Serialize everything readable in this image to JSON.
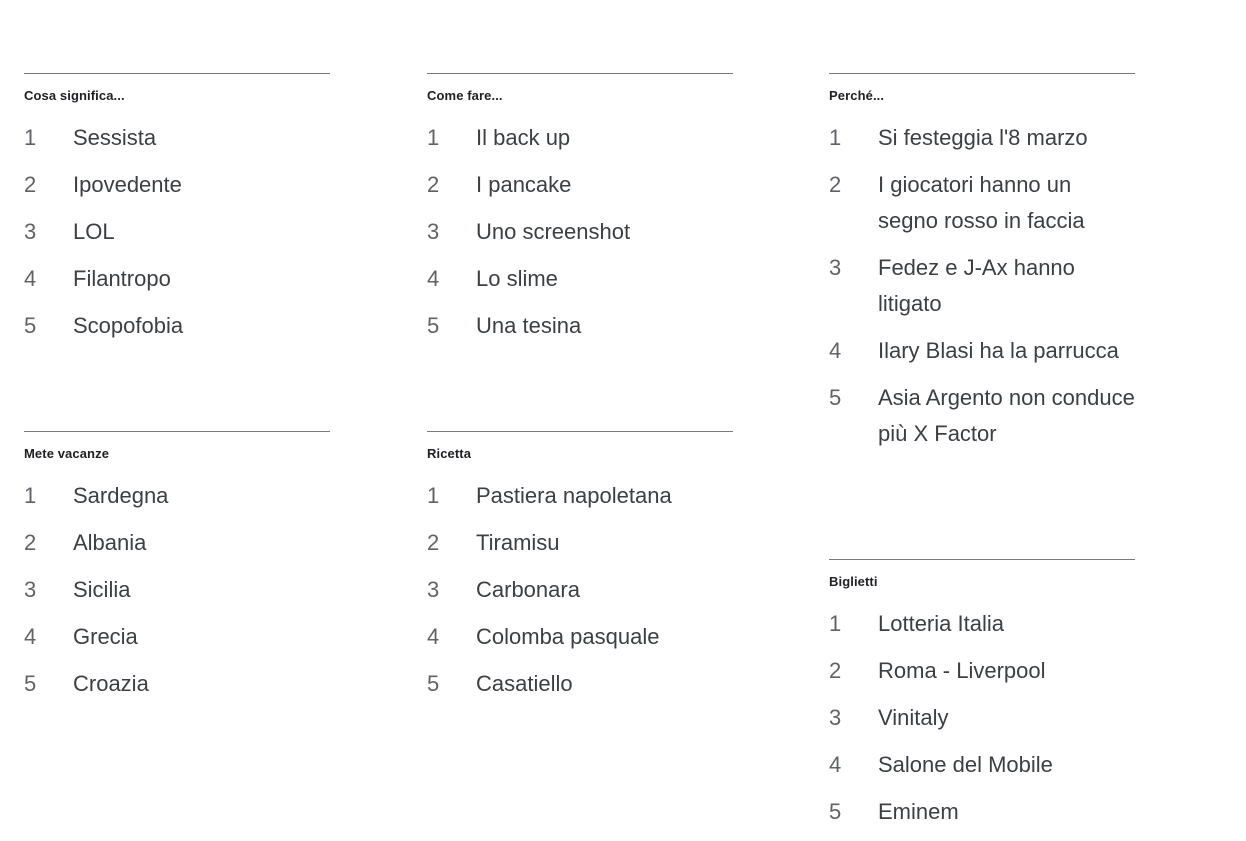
{
  "page": {
    "background_color": "#ffffff",
    "rule_color": "#5f6368",
    "title_color": "#202124",
    "rank_color": "#5f6368",
    "item_color": "#3c4043"
  },
  "columns": [
    {
      "name": "column-left",
      "cards": [
        {
          "title": "Cosa significa...",
          "items": [
            {
              "rank": "1",
              "label": "Sessista"
            },
            {
              "rank": "2",
              "label": "Ipovedente"
            },
            {
              "rank": "3",
              "label": "LOL"
            },
            {
              "rank": "4",
              "label": "Filantropo"
            },
            {
              "rank": "5",
              "label": "Scopofobia"
            }
          ]
        },
        {
          "title": "Mete vacanze",
          "items": [
            {
              "rank": "1",
              "label": "Sardegna"
            },
            {
              "rank": "2",
              "label": "Albania"
            },
            {
              "rank": "3",
              "label": "Sicilia"
            },
            {
              "rank": "4",
              "label": "Grecia"
            },
            {
              "rank": "5",
              "label": "Croazia"
            }
          ]
        }
      ]
    },
    {
      "name": "column-middle",
      "cards": [
        {
          "title": "Come fare...",
          "items": [
            {
              "rank": "1",
              "label": "Il back up"
            },
            {
              "rank": "2",
              "label": "I pancake"
            },
            {
              "rank": "3",
              "label": "Uno screenshot"
            },
            {
              "rank": "4",
              "label": "Lo slime"
            },
            {
              "rank": "5",
              "label": "Una tesina"
            }
          ]
        },
        {
          "title": "Ricetta",
          "items": [
            {
              "rank": "1",
              "label": "Pastiera napoletana"
            },
            {
              "rank": "2",
              "label": "Tiramisu"
            },
            {
              "rank": "3",
              "label": "Carbonara"
            },
            {
              "rank": "4",
              "label": "Colomba pasquale"
            },
            {
              "rank": "5",
              "label": "Casatiello"
            }
          ]
        }
      ]
    },
    {
      "name": "column-right",
      "cards": [
        {
          "title": "Perché...",
          "items": [
            {
              "rank": "1",
              "label": "Si festeggia l'8 marzo"
            },
            {
              "rank": "2",
              "label": "I giocatori hanno un segno rosso in faccia"
            },
            {
              "rank": "3",
              "label": "Fedez e J-Ax hanno litigato"
            },
            {
              "rank": "4",
              "label": "Ilary Blasi ha la parrucca"
            },
            {
              "rank": "5",
              "label": "Asia Argento non conduce più X Factor"
            }
          ]
        },
        {
          "title": "Biglietti",
          "items": [
            {
              "rank": "1",
              "label": "Lotteria Italia"
            },
            {
              "rank": "2",
              "label": "Roma - Liverpool"
            },
            {
              "rank": "3",
              "label": "Vinitaly"
            },
            {
              "rank": "4",
              "label": "Salone del Mobile"
            },
            {
              "rank": "5",
              "label": "Eminem"
            }
          ]
        }
      ]
    }
  ]
}
